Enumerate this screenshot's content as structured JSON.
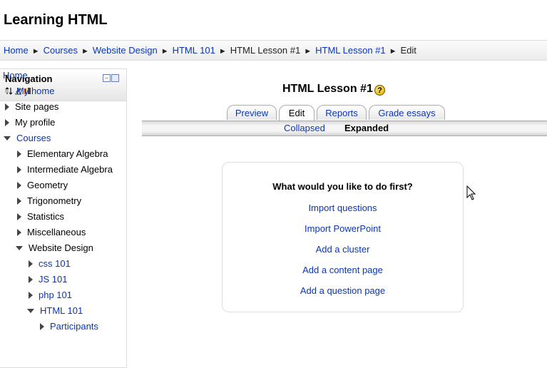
{
  "header": {
    "site_title": "Learning HTML"
  },
  "breadcrumb": {
    "items": [
      "Home",
      "Courses",
      "Website Design",
      "HTML 101",
      "HTML Lesson #1",
      "HTML Lesson #1",
      "Edit"
    ],
    "separator": "►"
  },
  "navigation": {
    "title": "Navigation",
    "tree": [
      {
        "label": "Home"
      },
      {
        "label": "My home"
      },
      {
        "label": "Site pages"
      },
      {
        "label": "My profile"
      },
      {
        "label": "Courses"
      },
      {
        "label": "Elementary Algebra"
      },
      {
        "label": "Intermediate Algebra"
      },
      {
        "label": "Geometry"
      },
      {
        "label": "Trigonometry"
      },
      {
        "label": "Statistics"
      },
      {
        "label": "Miscellaneous"
      },
      {
        "label": "Website Design"
      },
      {
        "label": "css 101"
      },
      {
        "label": "JS 101"
      },
      {
        "label": "php 101"
      },
      {
        "label": "HTML 101"
      },
      {
        "label": "Participants"
      }
    ]
  },
  "main": {
    "lesson_title": "HTML Lesson #1",
    "help_glyph": "?",
    "tabs": [
      {
        "label": "Preview"
      },
      {
        "label": "Edit"
      },
      {
        "label": "Reports"
      },
      {
        "label": "Grade essays"
      }
    ],
    "subtabs": {
      "collapsed": "Collapsed",
      "expanded": "Expanded"
    },
    "choices": {
      "heading": "What would you like to do first?",
      "links": [
        "Import questions",
        "Import PowerPoint",
        "Add a cluster",
        "Add a content page",
        "Add a question page"
      ]
    }
  },
  "colors": {
    "link": "#0a36b4",
    "text": "#000000",
    "border": "#dddddd"
  },
  "icons": [
    "help-icon",
    "nav-move-icon",
    "nav-edit-icon",
    "nav-config-icon",
    "block-dock-icon",
    "block-hide-icon",
    "arrow-cursor-icon"
  ]
}
